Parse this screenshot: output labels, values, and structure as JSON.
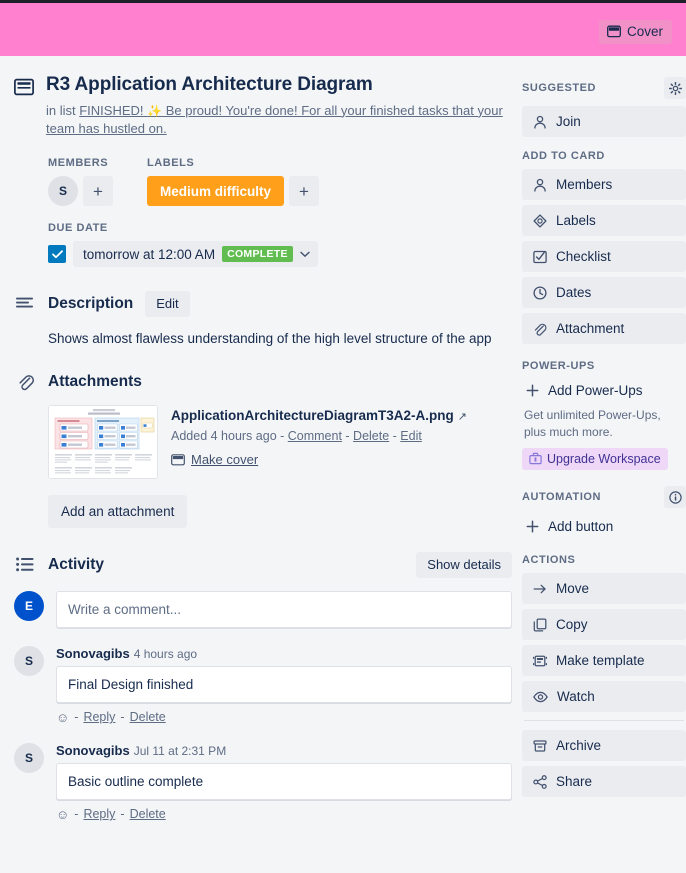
{
  "cover": {
    "button_label": "Cover",
    "banner_color": "#ff80ce",
    "button_color": "#f191c8"
  },
  "card": {
    "title": "R3 Application Architecture Diagram",
    "in_list_prefix": "in list ",
    "list_name": "FINISHED! ",
    "list_emoji": "✨",
    "list_tagline": " Be proud! You're done! For all your finished tasks that your team has hustled on."
  },
  "members": {
    "heading": "MEMBERS",
    "avatar_initial": "S",
    "add_label": "+"
  },
  "labels": {
    "heading": "LABELS",
    "chip_label": "Medium difficulty",
    "chip_color": "#ff9f1a",
    "add_label": "+"
  },
  "due_date": {
    "heading": "DUE DATE",
    "value": "tomorrow at 12:00 AM",
    "badge": "COMPLETE",
    "badge_color": "#61bd4f",
    "checked": true,
    "caret": "⌄"
  },
  "description": {
    "heading": "Description",
    "edit_label": "Edit",
    "text": "Shows almost flawless understanding of the high level structure of the app"
  },
  "attachments": {
    "heading": "Attachments",
    "items": [
      {
        "name": "ApplicationArchitectureDiagramT3A2-A.png",
        "added": "Added 4 hours ago",
        "sep": " - ",
        "comment_label": "Comment",
        "delete_label": "Delete",
        "edit_label": "Edit",
        "make_cover_label": "Make cover"
      }
    ],
    "add_button": "Add an attachment"
  },
  "activity": {
    "heading": "Activity",
    "show_details_label": "Show details",
    "composer": {
      "avatar_initial": "E",
      "avatar_color": "#0052cc",
      "placeholder": "Write a comment..."
    },
    "items": [
      {
        "avatar_initial": "S",
        "author": "Sonovagibs",
        "time": "4 hours ago",
        "text": "Final Design finished",
        "reply_label": "Reply",
        "delete_label": "Delete",
        "sep": "-"
      },
      {
        "avatar_initial": "S",
        "author": "Sonovagibs",
        "time": "Jul 11 at 2:31 PM",
        "text": "Basic outline complete",
        "reply_label": "Reply",
        "delete_label": "Delete",
        "sep": "-"
      }
    ]
  },
  "sidebar": {
    "suggested": {
      "heading": "SUGGESTED",
      "items": [
        {
          "label": "Join",
          "icon": "person-icon"
        }
      ]
    },
    "add_to_card": {
      "heading": "ADD TO CARD",
      "items": [
        {
          "label": "Members",
          "icon": "person-icon"
        },
        {
          "label": "Labels",
          "icon": "label-icon"
        },
        {
          "label": "Checklist",
          "icon": "checklist-icon"
        },
        {
          "label": "Dates",
          "icon": "clock-icon"
        },
        {
          "label": "Attachment",
          "icon": "paperclip-icon"
        }
      ]
    },
    "power_ups": {
      "heading": "POWER-UPS",
      "add_label": "Add Power-Ups",
      "note": "Get unlimited Power-Ups, plus much more.",
      "upgrade_label": "Upgrade Workspace",
      "upgrade_color": "#eed7f7"
    },
    "automation": {
      "heading": "AUTOMATION",
      "add_label": "Add button"
    },
    "actions": {
      "heading": "ACTIONS",
      "items": [
        {
          "label": "Move",
          "icon": "arrow-right-icon"
        },
        {
          "label": "Copy",
          "icon": "copy-icon"
        },
        {
          "label": "Make template",
          "icon": "template-icon"
        },
        {
          "label": "Watch",
          "icon": "eye-icon"
        }
      ],
      "items_after_divider": [
        {
          "label": "Archive",
          "icon": "archive-icon"
        },
        {
          "label": "Share",
          "icon": "share-icon"
        }
      ]
    }
  }
}
